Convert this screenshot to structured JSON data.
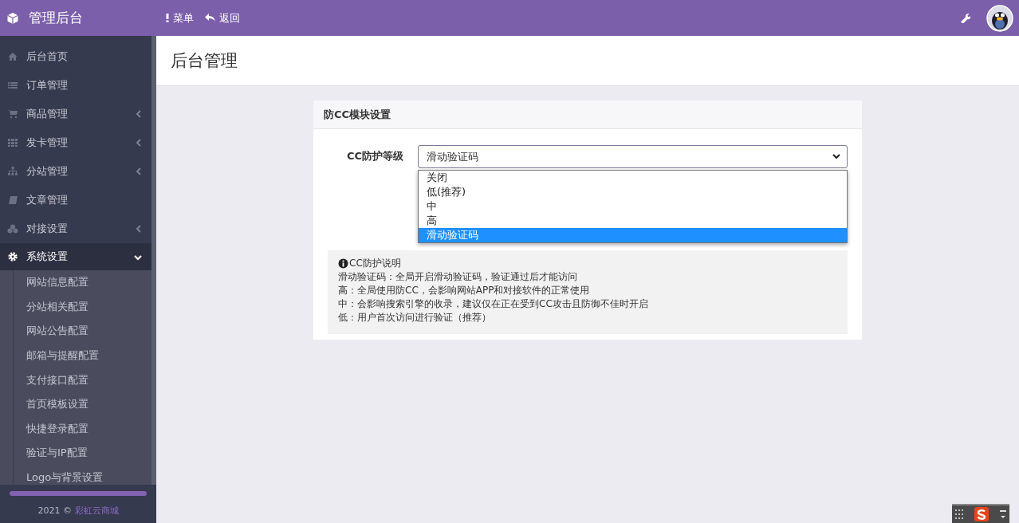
{
  "header": {
    "brand": "管理后台",
    "toolbar": [
      "菜单",
      "返回"
    ]
  },
  "sidebar": {
    "items": [
      {
        "label": "后台首页",
        "kind": "link"
      },
      {
        "label": "订单管理",
        "kind": "link"
      },
      {
        "label": "商品管理",
        "kind": "group",
        "expanded": false
      },
      {
        "label": "发卡管理",
        "kind": "group",
        "expanded": false
      },
      {
        "label": "分站管理",
        "kind": "group",
        "expanded": false
      },
      {
        "label": "文章管理",
        "kind": "link"
      },
      {
        "label": "对接设置",
        "kind": "group",
        "expanded": false
      },
      {
        "label": "系统设置",
        "kind": "group",
        "expanded": true,
        "children": [
          "网站信息配置",
          "分站相关配置",
          "网站公告配置",
          "邮箱与提醒配置",
          "支付接口配置",
          "首页模板设置",
          "快捷登录配置",
          "验证与IP配置",
          "Logo与背景设置"
        ]
      }
    ],
    "footer": {
      "text": "2021 ©",
      "link": "彩虹云商城"
    }
  },
  "page_title": "后台管理",
  "card": {
    "title": "防CC模块设置",
    "field": {
      "label": "CC防护等级",
      "value": "滑动验证码",
      "expanded": true,
      "options": [
        {
          "label": "关闭",
          "selected": false
        },
        {
          "label": "低(推荐)",
          "selected": false
        },
        {
          "label": "中",
          "selected": false
        },
        {
          "label": "高",
          "selected": false
        },
        {
          "label": "滑动验证码",
          "selected": true
        }
      ]
    },
    "notice": {
      "title": "CC防护说明",
      "lines": [
        "滑动验证码：全局开启滑动验证码，验证通过后才能访问",
        "高：全局使用防CC，会影响网站APP和对接软件的正常使用",
        "中：会影响搜索引擎的收录，建议仅在正在受到CC攻击且防御不佳时开启",
        "低：用户首次访问进行验证（推荐）"
      ]
    }
  }
}
